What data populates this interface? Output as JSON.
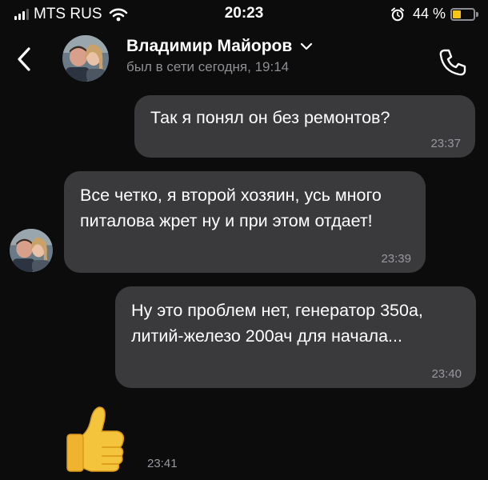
{
  "status_bar": {
    "carrier": "MTS RUS",
    "time": "20:23",
    "battery_percent": "44 %",
    "battery_level": 0.44,
    "battery_color": "#f5c518"
  },
  "header": {
    "contact_name": "Владимир Майоров",
    "contact_status": "был в сети сегодня, 19:14",
    "icons": [
      "back-chevron-icon",
      "avatar-photo",
      "chevron-down-icon",
      "phone-icon"
    ]
  },
  "messages": [
    {
      "direction": "outgoing",
      "text": "Так я понял он без ремонтов?",
      "time": "23:37"
    },
    {
      "direction": "incoming",
      "text": "Все четко, я второй хозяин, усь много питалова жрет ну и при этом отдает!",
      "time": "23:39"
    },
    {
      "direction": "outgoing",
      "text": "Ну это проблем нет, генератор 350а, литий-железо 200ач для начала...",
      "time": "23:40"
    },
    {
      "direction": "incoming",
      "sticker": "thumbs-up",
      "time": "23:41"
    }
  ],
  "colors": {
    "background": "#0c0c0d",
    "bubble": "#3a3a3c",
    "secondary_text": "#8e8e93"
  }
}
